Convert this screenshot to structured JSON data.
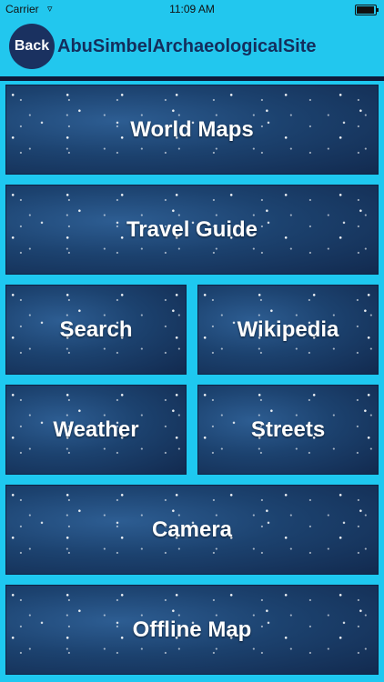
{
  "status_bar": {
    "carrier": "Carrier",
    "time": "11:09 AM"
  },
  "header": {
    "back_label": "Back",
    "title": "AbuSimbelArchaeologicalSite"
  },
  "menu": {
    "world_maps": "World Maps",
    "travel_guide": "Travel Guide",
    "search": "Search",
    "wikipedia": "Wikipedia",
    "weather": "Weather",
    "streets": "Streets",
    "camera": "Camera",
    "offline_map": "Offline Map"
  },
  "colors": {
    "background": "#1ec8f0",
    "nav_bar": "#22c7ee",
    "back_button": "#1a3160",
    "title_text": "#142e5c"
  },
  "icons": {
    "wifi": "wifi-icon",
    "battery": "battery-icon"
  }
}
